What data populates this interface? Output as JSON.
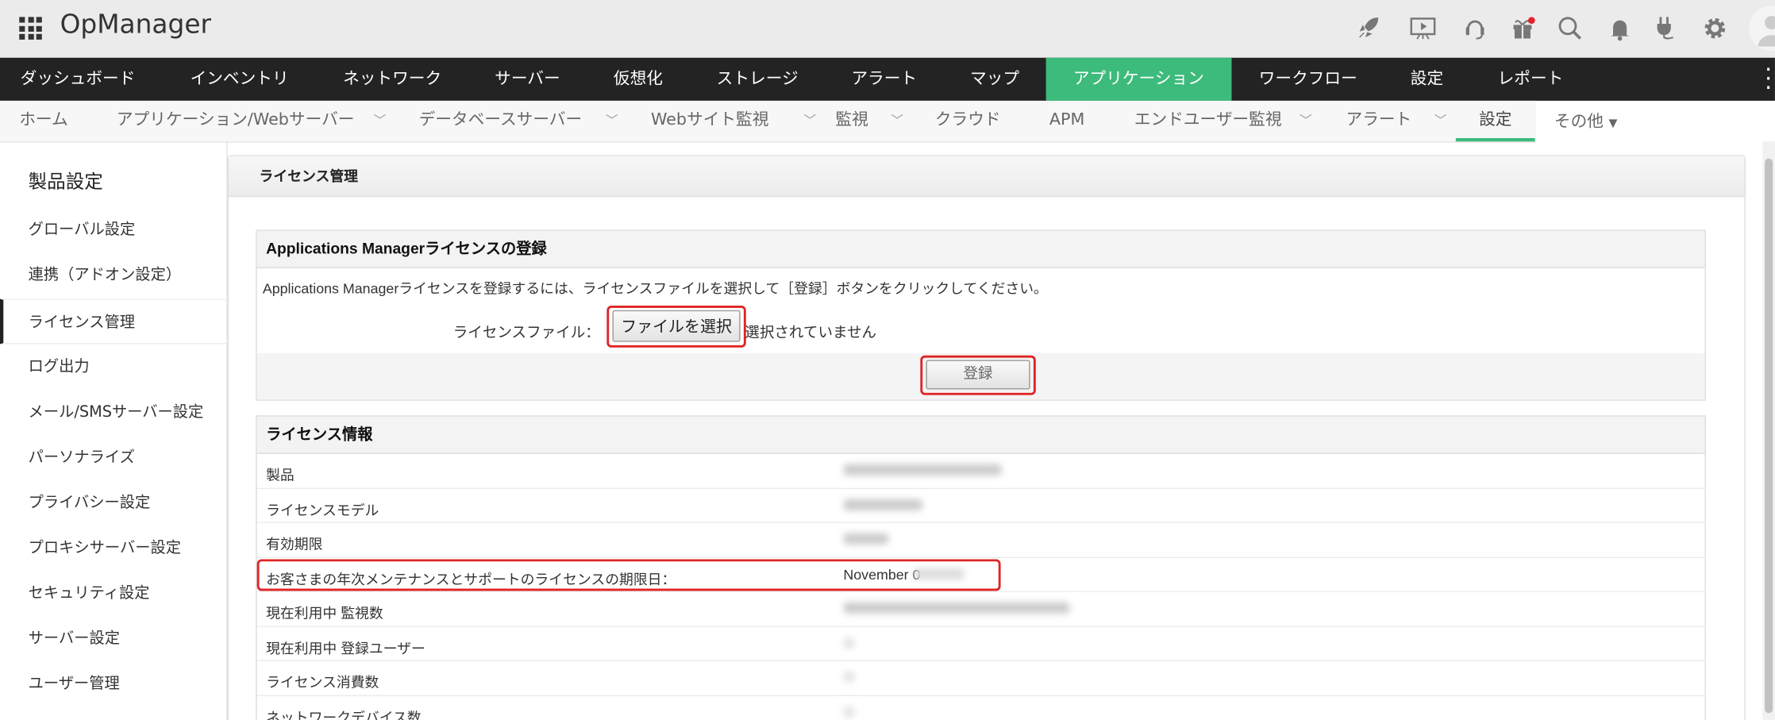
{
  "topbar": {
    "app_title": "OpManager",
    "icons": [
      "rocket-icon",
      "presentation-icon",
      "headset-icon",
      "gift-icon",
      "search-icon",
      "bell-icon",
      "plug-icon",
      "gear-icon",
      "avatar-icon"
    ]
  },
  "main_nav": [
    "ダッシュボード",
    "インベントリ",
    "ネットワーク",
    "サーバー",
    "仮想化",
    "ストレージ",
    "アラート",
    "マップ",
    "アプリケーション",
    "ワークフロー",
    "設定",
    "レポート"
  ],
  "main_nav_active": "アプリケーション",
  "sub_nav": [
    "ホーム",
    "アプリケーション/Webサーバー",
    "データベースサーバー",
    "Webサイト監視",
    "監視",
    "クラウド",
    "APM",
    "エンドユーザー監視",
    "アラート",
    "設定",
    "その他"
  ],
  "sub_nav_active": "設定",
  "sidebar": {
    "title": "製品設定",
    "items": [
      "グローバル設定",
      "連携（アドオン設定）",
      "ライセンス管理",
      "ログ出力",
      "メール/SMSサーバー設定",
      "パーソナライズ",
      "プライバシー設定",
      "プロキシサーバー設定",
      "セキュリティ設定",
      "サーバー設定",
      "ユーザー管理"
    ],
    "active": "ライセンス管理"
  },
  "panel": {
    "title": "ライセンス管理",
    "register": {
      "title": "Applications Managerライセンスの登録",
      "description": "Applications Managerライセンスを登録するには、ライセンスファイルを選択して［登録］ボタンをクリックしてください。",
      "file_label": "ライセンスファイル：",
      "choose_file": "ファイルを選択",
      "no_file": "選択されていません",
      "submit": "登録"
    },
    "info": {
      "title": "ライセンス情報",
      "rows": [
        {
          "label": "製品",
          "value": null
        },
        {
          "label": "ライセンスモデル",
          "value": null
        },
        {
          "label": "有効期限",
          "value": null
        },
        {
          "label": "お客さまの年次メンテナンスとサポートのライセンスの期限日：",
          "value": "November 0"
        },
        {
          "label": "現在利用中 監視数",
          "value": null
        },
        {
          "label": "現在利用中 登録ユーザー",
          "value": null
        },
        {
          "label": "ライセンス消費数",
          "value": null
        },
        {
          "label": "ネットワークデバイス数",
          "value": null
        }
      ]
    }
  },
  "colors": {
    "accent": "#3dbb7c",
    "nav_bg": "#232323",
    "highlight": "#e02424"
  }
}
